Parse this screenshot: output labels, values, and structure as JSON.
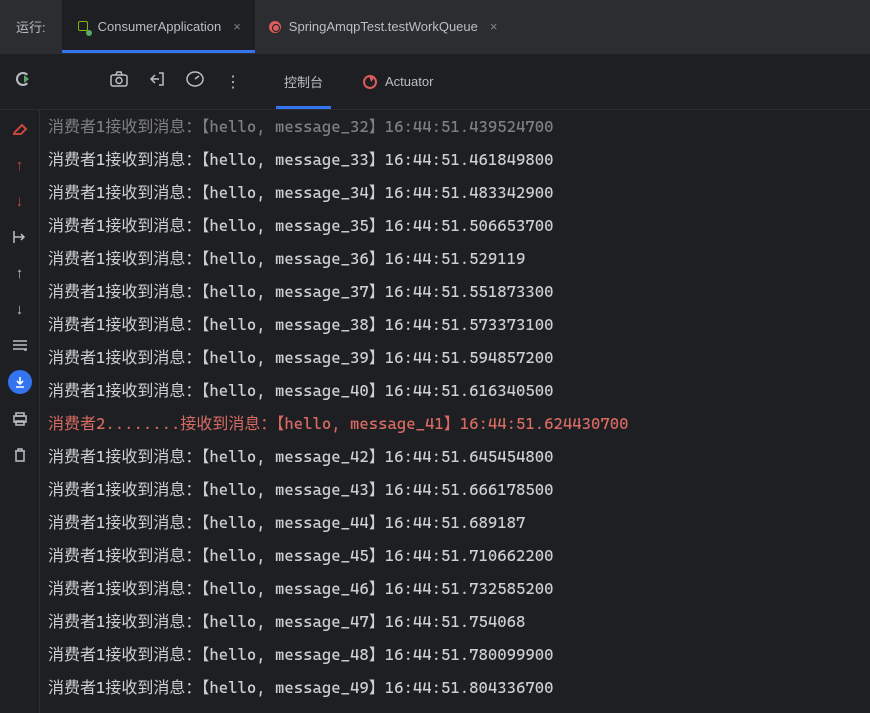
{
  "topbar": {
    "running_label": "运行:",
    "tabs": [
      {
        "label": "ConsumerApplication",
        "active": true
      },
      {
        "label": "SpringAmqpTest.testWorkQueue",
        "active": false
      }
    ]
  },
  "subtabs": {
    "console_label": "控制台",
    "actuator_label": "Actuator"
  },
  "console": {
    "fade_row": "消费者1接收到消息：【hello, message_32】16:44:51.439524700",
    "rows": [
      "消费者1接收到消息：【hello, message_33】16:44:51.461849800",
      "消费者1接收到消息：【hello, message_34】16:44:51.483342900",
      "消费者1接收到消息：【hello, message_35】16:44:51.506653700",
      "消费者1接收到消息：【hello, message_36】16:44:51.529119",
      "消费者1接收到消息：【hello, message_37】16:44:51.551873300",
      "消费者1接收到消息：【hello, message_38】16:44:51.573373100",
      "消费者1接收到消息：【hello, message_39】16:44:51.594857200",
      "消费者1接收到消息：【hello, message_40】16:44:51.616340500"
    ],
    "red_row": "消费者2........接收到消息：【hello, message_41】16:44:51.624430700",
    "rows2": [
      "消费者1接收到消息：【hello, message_42】16:44:51.645454800",
      "消费者1接收到消息：【hello, message_43】16:44:51.666178500",
      "消费者1接收到消息：【hello, message_44】16:44:51.689187",
      "消费者1接收到消息：【hello, message_45】16:44:51.710662200",
      "消费者1接收到消息：【hello, message_46】16:44:51.732585200",
      "消费者1接收到消息：【hello, message_47】16:44:51.754068",
      "消费者1接收到消息：【hello, message_48】16:44:51.780099900",
      "消费者1接收到消息：【hello, message_49】16:44:51.804336700"
    ]
  }
}
